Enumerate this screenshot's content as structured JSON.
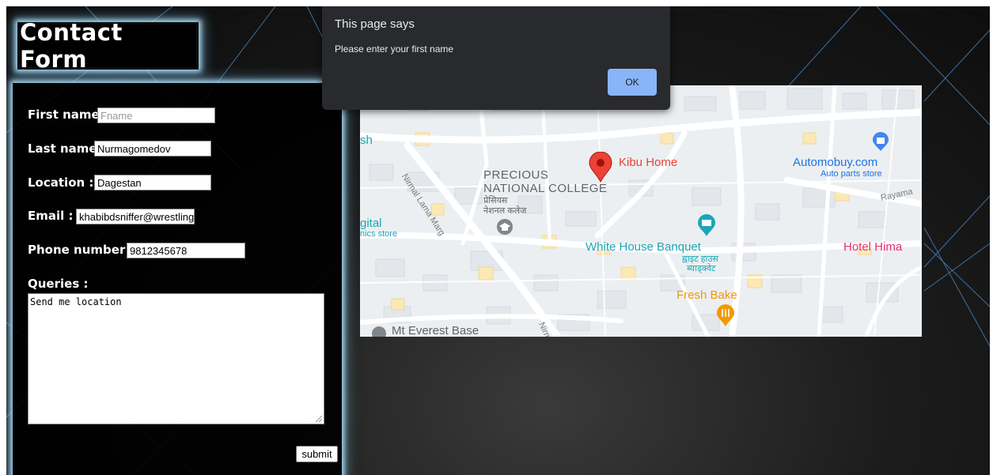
{
  "form": {
    "title": "Contact Form",
    "fields": {
      "first_name": {
        "label": "First name:",
        "value": "",
        "placeholder": "Fname"
      },
      "last_name": {
        "label": "Last name:",
        "value": "Nurmagomedov"
      },
      "location": {
        "label": "Location :",
        "value": "Dagestan"
      },
      "email": {
        "label": "Email :",
        "value": "khabibdsniffer@wrestling"
      },
      "phone": {
        "label": "Phone number :",
        "value": "9812345678"
      },
      "queries": {
        "label": "Queries :",
        "value": "Send me location"
      }
    },
    "submit_label": "submit"
  },
  "alert": {
    "title": "This page says",
    "message": "Please enter your first name",
    "ok_label": "OK"
  },
  "map": {
    "labels": {
      "sh": "sh",
      "precious1": "PRECIOUS",
      "precious2": "NATIONAL COLLEGE",
      "precious_np1": "प्रेसियस",
      "precious_np2": "नेशनल कलेज",
      "kibu": "Kibu Home",
      "automobuy": "Automobuy.com",
      "automobuy_sub": "Auto parts store",
      "rayama": "Rayama",
      "gital": "gital",
      "nics": "nics store",
      "white_house": "White House Banquet",
      "white_house_np1": "ह्वाइट हाउस",
      "white_house_np2": "ब्याड्क्वेट",
      "hotel": "Hotel Hima",
      "fresh_bake": "Fresh Bake",
      "everest": "Mt Everest Base",
      "nirmal": "Nirmal Lama Marg",
      "nirm": "Nirm"
    },
    "colors": {
      "pin": "#ea4335",
      "teal": "#1aa6b7",
      "blue": "#4285f4",
      "orange": "#f29900",
      "pink": "#e8306f"
    }
  }
}
